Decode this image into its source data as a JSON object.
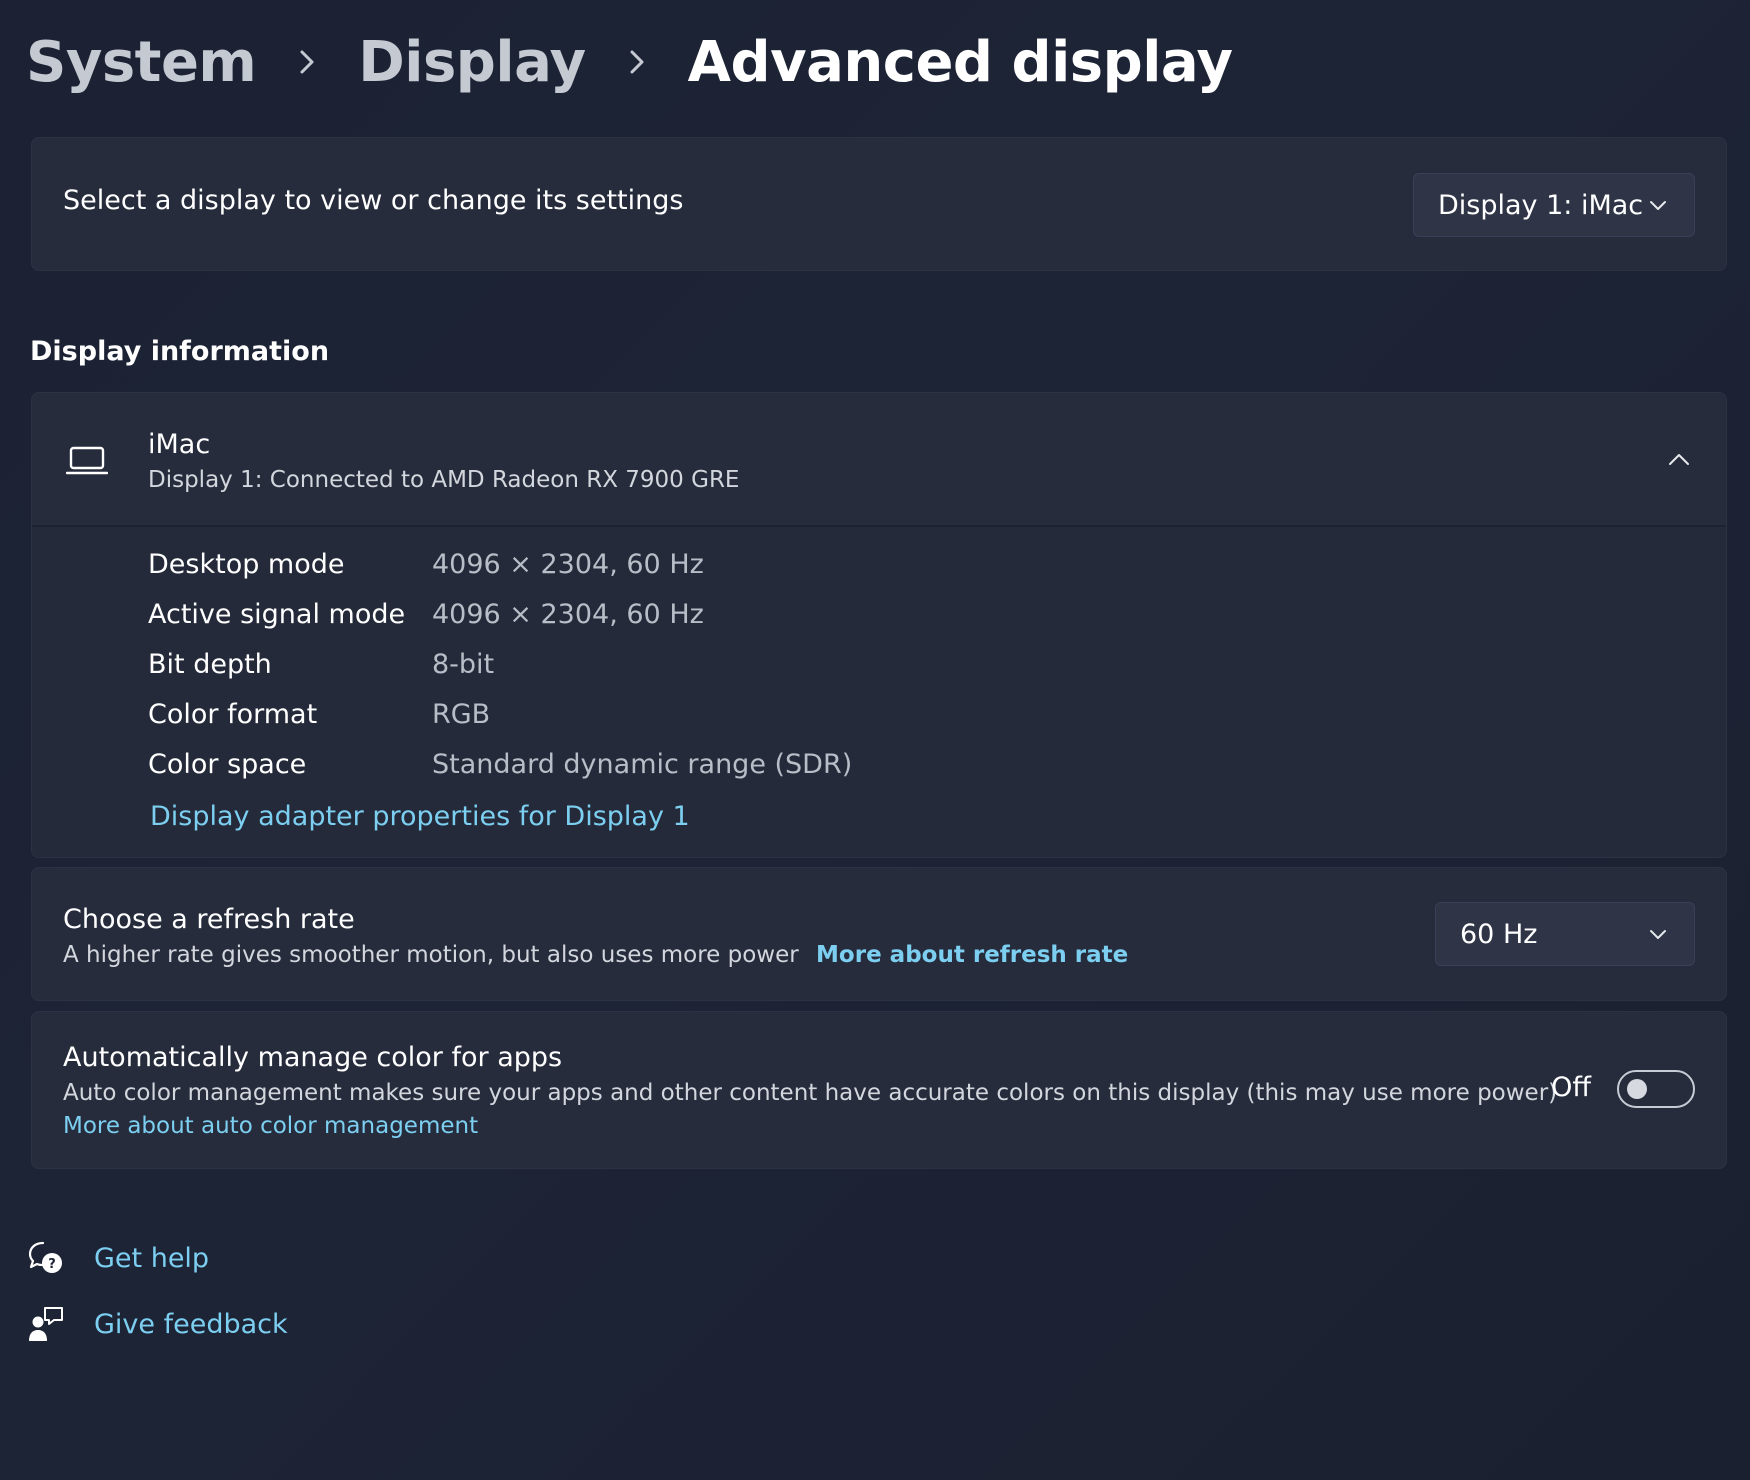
{
  "breadcrumb": {
    "items": [
      "System",
      "Display",
      "Advanced display"
    ]
  },
  "select_display": {
    "label": "Select a display to view or change its settings",
    "selected": "Display 1: iMac"
  },
  "display_information": {
    "heading": "Display information",
    "device_name": "iMac",
    "connection": "Display 1: Connected to AMD Radeon RX 7900 GRE",
    "expanded": true,
    "specs": [
      {
        "label": "Desktop mode",
        "value": "4096 × 2304, 60 Hz"
      },
      {
        "label": "Active signal mode",
        "value": "4096 × 2304, 60 Hz"
      },
      {
        "label": "Bit depth",
        "value": "8-bit"
      },
      {
        "label": "Color format",
        "value": "RGB"
      },
      {
        "label": "Color space",
        "value": "Standard dynamic range (SDR)"
      }
    ],
    "adapter_link": "Display adapter properties for Display 1"
  },
  "refresh_rate": {
    "title": "Choose a refresh rate",
    "description": "A higher rate gives smoother motion, but also uses more power",
    "link": "More about refresh rate",
    "selected": "60 Hz"
  },
  "auto_color": {
    "title": "Automatically manage color for apps",
    "description": "Auto color management makes sure your apps and other content have accurate colors on this display (this may use more power)",
    "link": "More about auto color management",
    "state_label": "Off",
    "enabled": false
  },
  "footer": {
    "get_help": "Get help",
    "give_feedback": "Give feedback"
  },
  "colors": {
    "accent_link": "#7ccff0",
    "card_background": "#262c3c",
    "page_background": "#1c2233"
  },
  "icons": {
    "breadcrumb_separator": "chevron-right-icon",
    "dropdown": "chevron-down-icon",
    "collapse": "chevron-up-icon",
    "display": "laptop-icon",
    "help": "help-chat-icon",
    "feedback": "feedback-person-icon"
  }
}
